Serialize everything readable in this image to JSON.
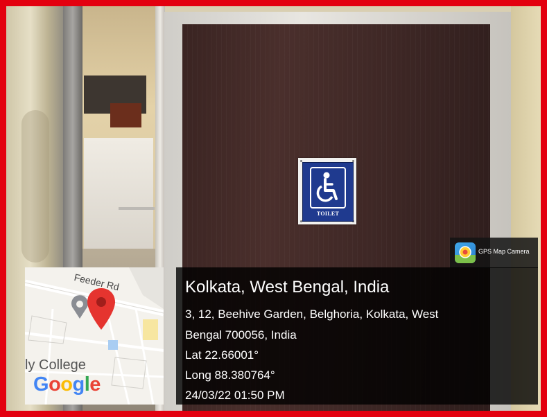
{
  "photo": {
    "description_icons": [
      "wheelchair-icon",
      "map-pin-icon",
      "gps-camera-icon"
    ],
    "accent_border_color": "#e3000f"
  },
  "sign": {
    "label": "TOILET"
  },
  "gps_badge": {
    "label": "GPS Map Camera"
  },
  "map": {
    "street_label": "Feeder Rd",
    "place_label": "ly College",
    "logo_text": "Google",
    "logo_colors": [
      "#4285F4",
      "#EA4335",
      "#FBBC05",
      "#4285F4",
      "#34A853",
      "#EA4335"
    ]
  },
  "location": {
    "title": "Kolkata, West Bengal, India",
    "address_line1": "3, 12, Beehive Garden, Belghoria, Kolkata, West",
    "address_line2": "Bengal 700056, India",
    "lat": "Lat 22.66001°",
    "long": "Long 88.380764°",
    "datetime": "24/03/22 01:50 PM"
  }
}
